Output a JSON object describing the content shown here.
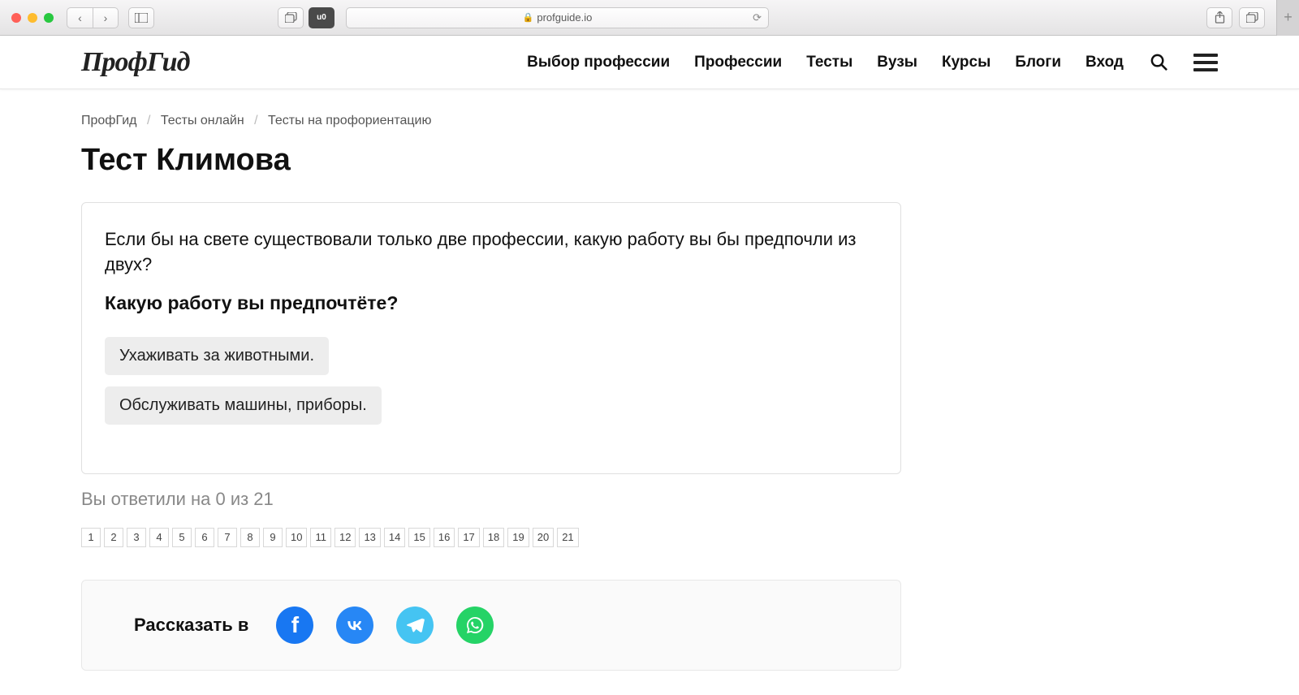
{
  "browser": {
    "url_host": "profguide.io"
  },
  "nav": {
    "items": [
      "Выбор профессии",
      "Профессии",
      "Тесты",
      "Вузы",
      "Курсы",
      "Блоги",
      "Вход"
    ]
  },
  "logo": "ПрофГид",
  "breadcrumbs": {
    "home": "ПрофГид",
    "tests": "Тесты онлайн",
    "current": "Тесты на профориентацию"
  },
  "page": {
    "title": "Тест Климова"
  },
  "question": {
    "intro": "Если бы на свете существовали только две профессии, какую работу вы бы предпочли из двух?",
    "prompt": "Какую работу вы предпочтёте?",
    "answers": [
      "Ухаживать за животными.",
      "Обслуживать машины, приборы."
    ]
  },
  "progress": {
    "text": "Вы ответили на 0 из 21",
    "answered": 0,
    "total": 21
  },
  "pager": [
    "1",
    "2",
    "3",
    "4",
    "5",
    "6",
    "7",
    "8",
    "9",
    "10",
    "11",
    "12",
    "13",
    "14",
    "15",
    "16",
    "17",
    "18",
    "19",
    "20",
    "21"
  ],
  "share": {
    "label": "Рассказать в",
    "networks": [
      "facebook",
      "vk",
      "telegram",
      "whatsapp"
    ]
  }
}
